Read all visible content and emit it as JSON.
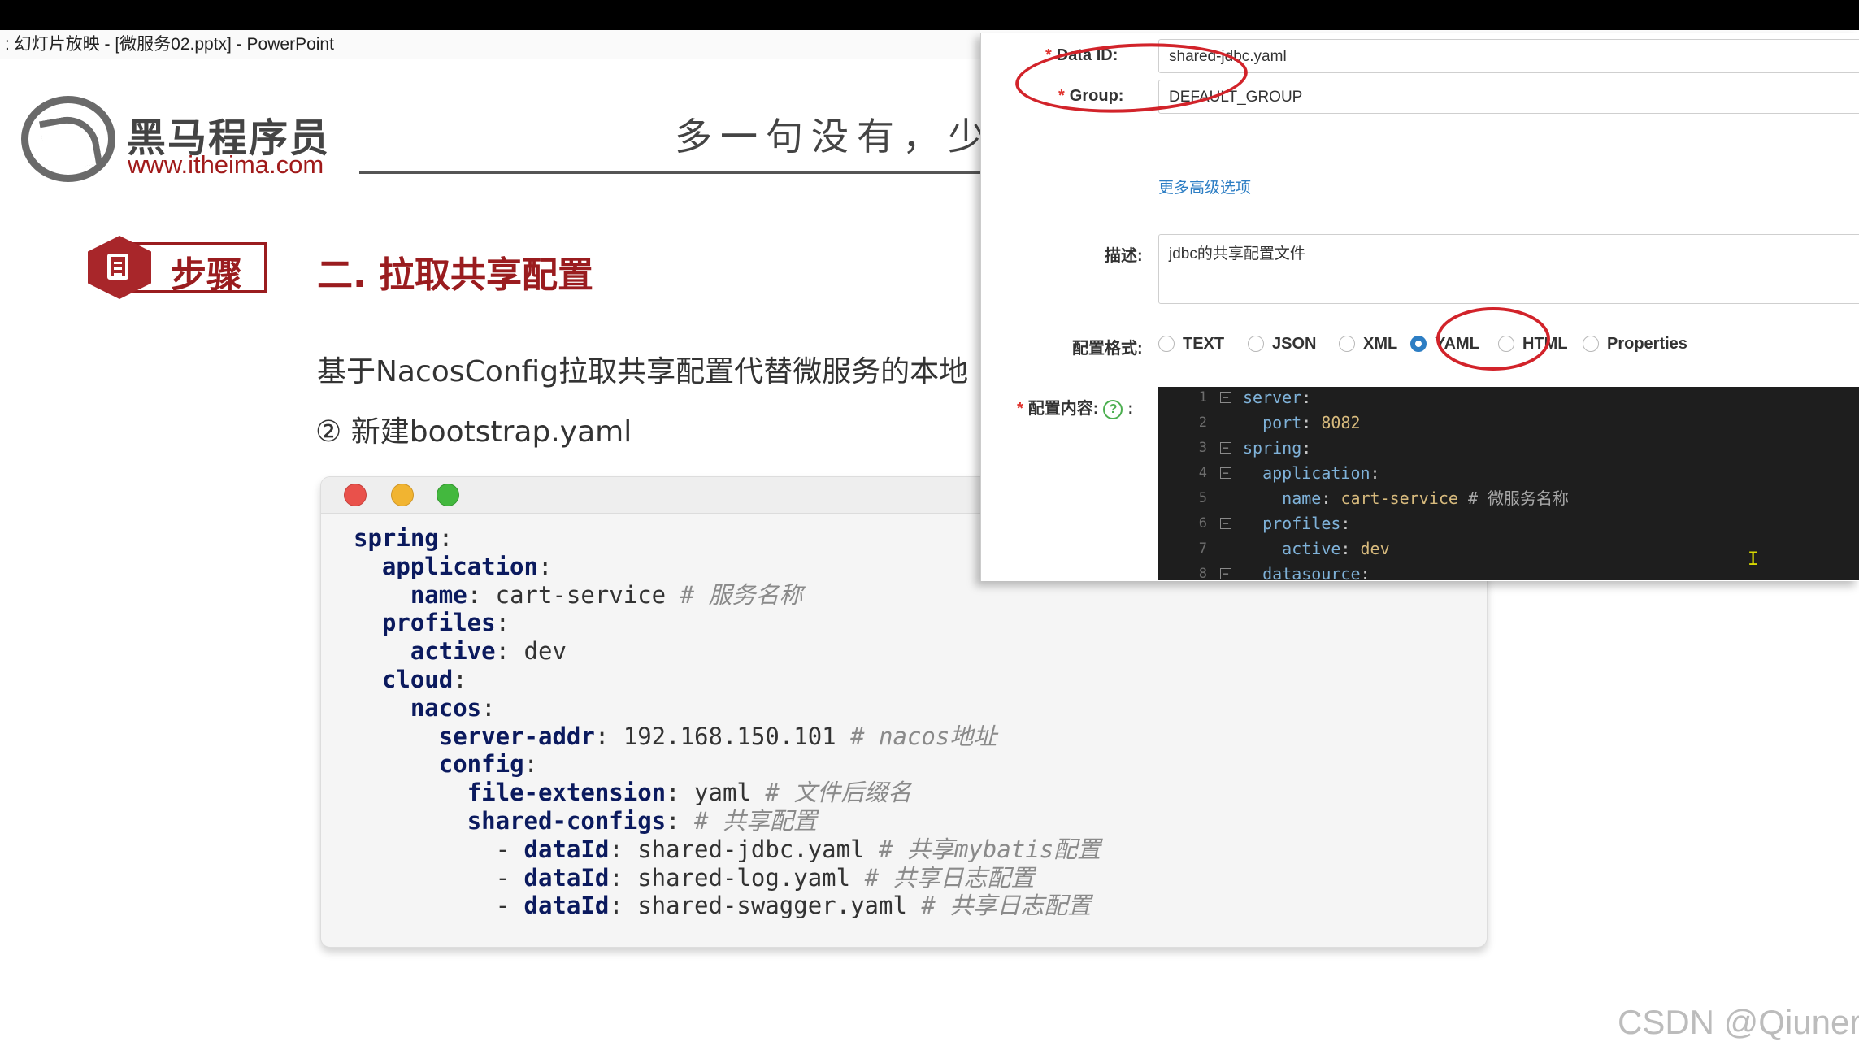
{
  "window": {
    "title": ": 幻灯片放映 - [微服务02.pptx] - PowerPoint"
  },
  "slide": {
    "brand_cn": "黑马程序员",
    "brand_url": "www.itheima.com",
    "motto": "多一句没有，少一",
    "step_label": "步骤",
    "section_title": "二. 拉取共享配置",
    "description": "基于NacosConfig拉取共享配置代替微服务的本地",
    "sub_item": "②  新建bootstrap.yaml",
    "code_lines": [
      {
        "indent": "",
        "key": "spring",
        "sep": ":",
        "value": "",
        "comment": ""
      },
      {
        "indent": "  ",
        "key": "application",
        "sep": ":",
        "value": "",
        "comment": ""
      },
      {
        "indent": "    ",
        "key": "name",
        "sep": ": ",
        "value": "cart-service",
        "comment": " # 服务名称"
      },
      {
        "indent": "  ",
        "key": "profiles",
        "sep": ":",
        "value": "",
        "comment": ""
      },
      {
        "indent": "    ",
        "key": "active",
        "sep": ": ",
        "value": "dev",
        "comment": ""
      },
      {
        "indent": "  ",
        "key": "cloud",
        "sep": ":",
        "value": "",
        "comment": ""
      },
      {
        "indent": "    ",
        "key": "nacos",
        "sep": ":",
        "value": "",
        "comment": ""
      },
      {
        "indent": "      ",
        "key": "server-addr",
        "sep": ": ",
        "value": "192.168.150.101",
        "comment": " # nacos地址"
      },
      {
        "indent": "      ",
        "key": "config",
        "sep": ":",
        "value": "",
        "comment": ""
      },
      {
        "indent": "        ",
        "key": "file-extension",
        "sep": ": ",
        "value": "yaml",
        "comment": " # 文件后缀名"
      },
      {
        "indent": "        ",
        "key": "shared-configs",
        "sep": ":",
        "value": "",
        "comment": " # 共享配置"
      },
      {
        "indent": "          - ",
        "key": "dataId",
        "sep": ": ",
        "value": "shared-jdbc.yaml",
        "comment": " # 共享mybatis配置"
      },
      {
        "indent": "          - ",
        "key": "dataId",
        "sep": ": ",
        "value": "shared-log.yaml",
        "comment": " # 共享日志配置"
      },
      {
        "indent": "          - ",
        "key": "dataId",
        "sep": ": ",
        "value": "shared-swagger.yaml",
        "comment": " # 共享日志配置"
      }
    ]
  },
  "dialog": {
    "data_id_label": "Data ID:",
    "data_id_value": "shared-jdbc.yaml",
    "group_label": "Group:",
    "group_value": "DEFAULT_GROUP",
    "advanced_link": "更多高级选项",
    "desc_label": "描述:",
    "desc_value": "jdbc的共享配置文件",
    "format_label": "配置格式:",
    "formats": [
      "TEXT",
      "JSON",
      "XML",
      "YAML",
      "HTML",
      "Properties"
    ],
    "selected_format": "YAML",
    "content_label": "配置内容:",
    "help_glyph": "?",
    "content_colon": ":",
    "required_mark": "*",
    "editor_lines": [
      {
        "num": "1",
        "fold": "⊟",
        "indent": "",
        "key": "server",
        "value": "",
        "comment": ""
      },
      {
        "num": "2",
        "fold": "",
        "indent": "  ",
        "key": "port",
        "value": "8082",
        "comment": ""
      },
      {
        "num": "3",
        "fold": "⊟",
        "indent": "",
        "key": "spring",
        "value": "",
        "comment": ""
      },
      {
        "num": "4",
        "fold": "⊟",
        "indent": "  ",
        "key": "application",
        "value": "",
        "comment": ""
      },
      {
        "num": "5",
        "fold": "",
        "indent": "    ",
        "key": "name",
        "value": "cart-service",
        "comment": " # 微服务名称"
      },
      {
        "num": "6",
        "fold": "⊟",
        "indent": "  ",
        "key": "profiles",
        "value": "",
        "comment": ""
      },
      {
        "num": "7",
        "fold": "",
        "indent": "    ",
        "key": "active",
        "value": "dev",
        "comment": ""
      },
      {
        "num": "8",
        "fold": "⊟",
        "indent": "  ",
        "key": "datasource",
        "value": "",
        "comment": ""
      }
    ]
  },
  "watermark": "CSDN @Qiuner",
  "colors": {
    "brand_red": "#9a1c1f",
    "annotation_red": "#d2232a",
    "link_blue": "#2d7ec4",
    "editor_bg": "#1e1e1e"
  }
}
